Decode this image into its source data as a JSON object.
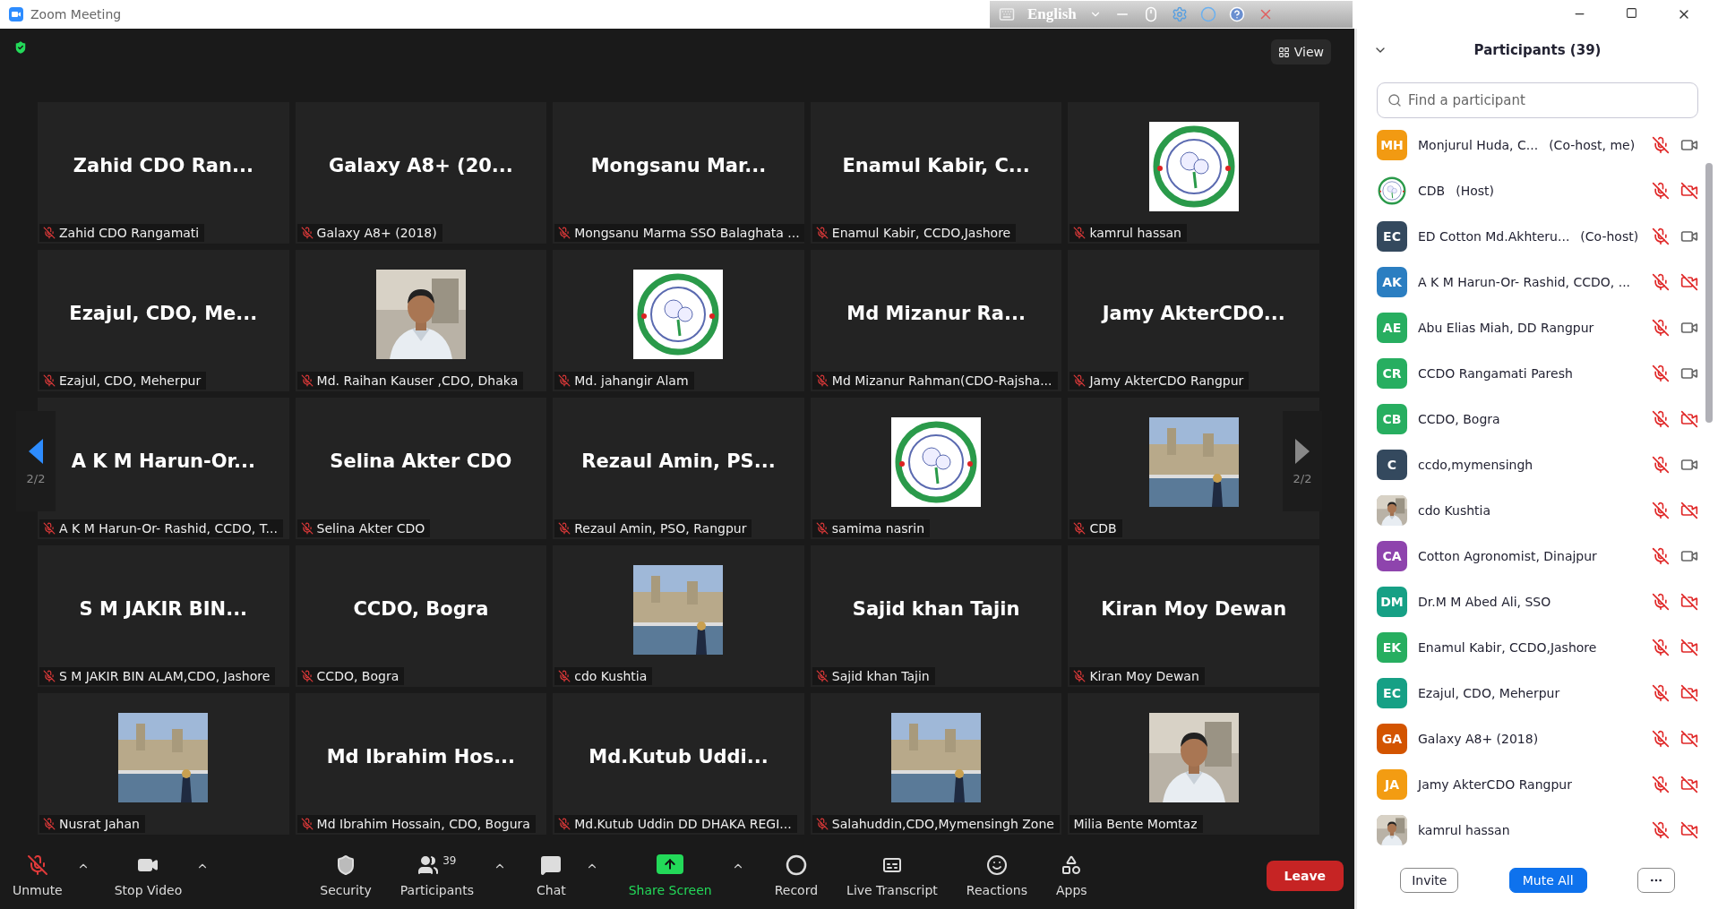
{
  "window": {
    "title": "Zoom Meeting"
  },
  "ime_bar": {
    "language": "English"
  },
  "top_bar": {
    "view_button": "View"
  },
  "gallery": {
    "nav": [
      {
        "page": "2/2",
        "active": true
      },
      {
        "page": "2/2",
        "active": false
      }
    ],
    "tiles": [
      {
        "kind": "name",
        "display": "Zahid CDO Ran...",
        "label": "Zahid CDO Rangamati",
        "muted": true
      },
      {
        "kind": "name",
        "display": "Galaxy A8+ (20...",
        "label": "Galaxy A8+ (2018)",
        "muted": true
      },
      {
        "kind": "name",
        "display": "Mongsanu Mar...",
        "label": "Mongsanu Marma SSO Balaghata ...",
        "muted": true
      },
      {
        "kind": "name",
        "display": "Enamul Kabir, C...",
        "label": "Enamul Kabir, CCDO,Jashore",
        "muted": true
      },
      {
        "kind": "picture",
        "label": "kamrul hassan",
        "muted": true
      },
      {
        "kind": "name",
        "display": "Ezajul, CDO, Me...",
        "label": "Ezajul, CDO, Meherpur",
        "muted": true
      },
      {
        "kind": "picture",
        "label": "Md. Raihan Kauser ,CDO, Dhaka",
        "muted": true
      },
      {
        "kind": "picture",
        "label": "Md. jahangir Alam",
        "muted": true
      },
      {
        "kind": "name",
        "display": "Md Mizanur Ra...",
        "label": "Md Mizanur Rahman(CDO-Rajsha...",
        "muted": true
      },
      {
        "kind": "name",
        "display": "Jamy AkterCDO...",
        "label": "Jamy AkterCDO Rangpur",
        "muted": true
      },
      {
        "kind": "name",
        "display": "A K M Harun-Or...",
        "label": "A K M Harun-Or- Rashid, CCDO, T...",
        "muted": true
      },
      {
        "kind": "name",
        "display": "Selina Akter CDO",
        "label": "Selina Akter CDO",
        "muted": true
      },
      {
        "kind": "name",
        "display": "Rezaul Amin, PS...",
        "label": "Rezaul Amin, PSO, Rangpur",
        "muted": true
      },
      {
        "kind": "picture",
        "label": "samima nasrin",
        "muted": true
      },
      {
        "kind": "picture",
        "label": "CDB",
        "muted": true
      },
      {
        "kind": "name",
        "display": "S M JAKIR BIN...",
        "label": "S M JAKIR BIN ALAM,CDO, Jashore",
        "muted": true
      },
      {
        "kind": "name",
        "display": "CCDO, Bogra",
        "label": "CCDO, Bogra",
        "muted": true
      },
      {
        "kind": "picture",
        "label": "cdo Kushtia",
        "muted": true
      },
      {
        "kind": "name",
        "display": "Sajid khan Tajin",
        "label": "Sajid khan Tajin",
        "muted": true
      },
      {
        "kind": "name",
        "display": "Kiran Moy Dewan",
        "label": "Kiran Moy Dewan",
        "muted": true
      },
      {
        "kind": "picture",
        "label": "Nusrat Jahan",
        "muted": true
      },
      {
        "kind": "name",
        "display": "Md Ibrahim Hos...",
        "label": "Md Ibrahim Hossain, CDO, Bogura",
        "muted": true
      },
      {
        "kind": "name",
        "display": "Md.Kutub Uddi...",
        "label": "Md.Kutub Uddin DD DHAKA REGI...",
        "muted": true
      },
      {
        "kind": "picture",
        "label": "Salahuddin,CDO,Mymensingh Zone",
        "muted": true
      },
      {
        "kind": "picture",
        "label": "Milia Bente Momtaz",
        "muted": false
      }
    ]
  },
  "toolbar": [
    {
      "kind": "mic",
      "label": "Unmute",
      "muted": true,
      "caret": true
    },
    {
      "kind": "video",
      "label": "Stop Video",
      "caret": true
    },
    {
      "kind": "security",
      "label": "Security",
      "caret": false
    },
    {
      "kind": "participants",
      "label": "Participants",
      "count": "39",
      "caret": true
    },
    {
      "kind": "chat",
      "label": "Chat",
      "caret": true
    },
    {
      "kind": "share",
      "label": "Share Screen",
      "caret": true
    },
    {
      "kind": "record",
      "label": "Record",
      "caret": false
    },
    {
      "kind": "transcript",
      "label": "Live Transcript",
      "caret": false
    },
    {
      "kind": "reactions",
      "label": "Reactions",
      "caret": false
    },
    {
      "kind": "apps",
      "label": "Apps",
      "caret": false
    }
  ],
  "leave_button": "Leave",
  "participants": {
    "title": "Participants (39)",
    "search_placeholder": "Find a participant",
    "rows": [
      {
        "kind": "initials",
        "initials": "MH",
        "color": "#f29a12",
        "name": "Monjurul Huda, C...",
        "role": "(Co-host, me)",
        "muted": true,
        "video_off": false
      },
      {
        "kind": "picture",
        "name": "CDB",
        "role": "(Host)",
        "muted": true,
        "video_off": true
      },
      {
        "kind": "initials",
        "initials": "EC",
        "color": "#34495e",
        "name": "ED Cotton Md.Akhteru...",
        "role": "(Co-host)",
        "muted": true,
        "video_off": false
      },
      {
        "kind": "initials",
        "initials": "AK",
        "color": "#2b7ec1",
        "name": "A K M Harun-Or- Rashid, CCDO, ...",
        "muted": true,
        "video_off": true
      },
      {
        "kind": "initials",
        "initials": "AE",
        "color": "#27ae60",
        "name": "Abu Elias Miah, DD Rangpur",
        "muted": true,
        "video_off": false
      },
      {
        "kind": "initials",
        "initials": "CR",
        "color": "#27ae60",
        "name": "CCDO Rangamati Paresh",
        "muted": true,
        "video_off": false
      },
      {
        "kind": "initials",
        "initials": "CB",
        "color": "#27ae60",
        "name": "CCDO, Bogra",
        "muted": true,
        "video_off": true
      },
      {
        "kind": "initials",
        "initials": "C",
        "color": "#34495e",
        "name": "ccdo,mymensingh",
        "muted": true,
        "video_off": false
      },
      {
        "kind": "picture",
        "name": "cdo Kushtia",
        "muted": true,
        "video_off": true
      },
      {
        "kind": "initials",
        "initials": "CA",
        "color": "#8e44ad",
        "name": "Cotton Agronomist, Dinajpur",
        "muted": true,
        "video_off": false
      },
      {
        "kind": "initials",
        "initials": "DM",
        "color": "#16a085",
        "name": "Dr.M M Abed Ali, SSO",
        "muted": true,
        "video_off": true
      },
      {
        "kind": "initials",
        "initials": "EK",
        "color": "#27ae60",
        "name": "Enamul Kabir, CCDO,Jashore",
        "muted": true,
        "video_off": true
      },
      {
        "kind": "initials",
        "initials": "EC",
        "color": "#16a085",
        "name": "Ezajul, CDO, Meherpur",
        "muted": true,
        "video_off": true
      },
      {
        "kind": "initials",
        "initials": "GA",
        "color": "#d35400",
        "name": "Galaxy A8+ (2018)",
        "muted": true,
        "video_off": true
      },
      {
        "kind": "initials",
        "initials": "JA",
        "color": "#f39c12",
        "name": "Jamy AkterCDO Rangpur",
        "muted": true,
        "video_off": true
      },
      {
        "kind": "picture",
        "name": "kamrul hassan",
        "muted": true,
        "video_off": true
      }
    ],
    "invite_button": "Invite",
    "mute_all_button": "Mute All"
  }
}
